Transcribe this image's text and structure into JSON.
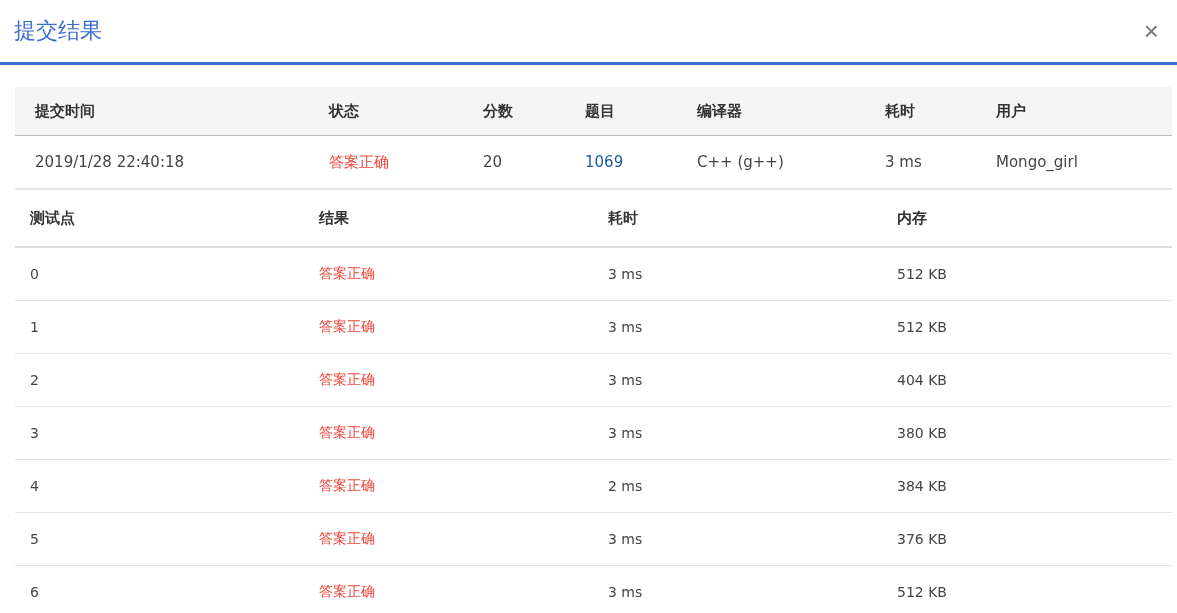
{
  "dialog": {
    "title": "提交结果",
    "close": "×"
  },
  "summary": {
    "columns": [
      "提交时间",
      "状态",
      "分数",
      "题目",
      "编译器",
      "耗时",
      "用户"
    ],
    "row": {
      "time": "2019/1/28 22:40:18",
      "status": {
        "text": "答案正确",
        "kind": "accepted"
      },
      "score": "20",
      "problem": "1069",
      "compiler": "C++ (g++)",
      "duration": "3 ms",
      "user": "Mongo_girl"
    }
  },
  "cases": {
    "columns": [
      "测试点",
      "结果",
      "耗时",
      "内存"
    ],
    "rows": [
      {
        "id": "0",
        "result": {
          "text": "答案正确",
          "kind": "accepted"
        },
        "time": "3 ms",
        "memory": "512 KB"
      },
      {
        "id": "1",
        "result": {
          "text": "答案正确",
          "kind": "accepted"
        },
        "time": "3 ms",
        "memory": "512 KB"
      },
      {
        "id": "2",
        "result": {
          "text": "答案正确",
          "kind": "accepted"
        },
        "time": "3 ms",
        "memory": "404 KB"
      },
      {
        "id": "3",
        "result": {
          "text": "答案正确",
          "kind": "accepted"
        },
        "time": "3 ms",
        "memory": "380 KB"
      },
      {
        "id": "4",
        "result": {
          "text": "答案正确",
          "kind": "accepted"
        },
        "time": "2 ms",
        "memory": "384 KB"
      },
      {
        "id": "5",
        "result": {
          "text": "答案正确",
          "kind": "accepted"
        },
        "time": "3 ms",
        "memory": "376 KB"
      },
      {
        "id": "6",
        "result": {
          "text": "答案正确",
          "kind": "accepted"
        },
        "time": "3 ms",
        "memory": "512 KB"
      }
    ]
  }
}
